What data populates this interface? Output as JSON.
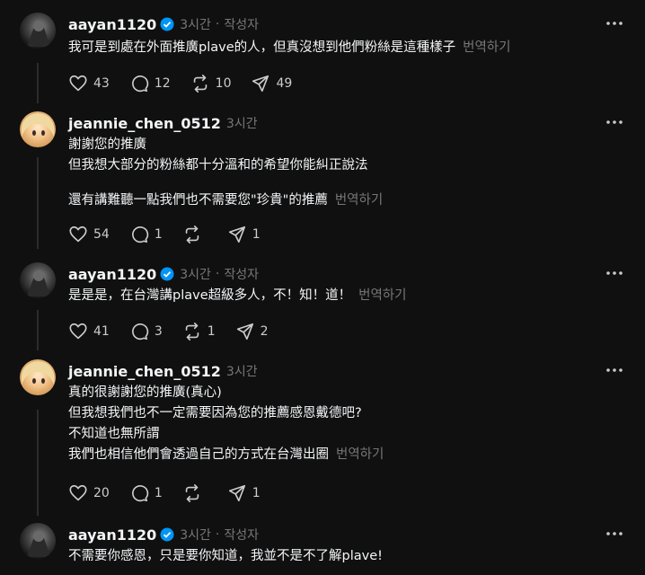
{
  "posts": [
    {
      "username": "aayan1120",
      "verified": true,
      "time": "3시간",
      "author_badge": "작성자",
      "lines": [
        "我可是到處在外面推廣plave的人，但真沒想到他們粉絲是這種樣子"
      ],
      "translate_label": "번역하기",
      "likes": "43",
      "comments": "12",
      "reposts": "10",
      "shares": "49"
    },
    {
      "username": "jeannie_chen_0512",
      "verified": false,
      "time": "3시간",
      "lines": [
        "謝謝您的推廣",
        "但我想大部分的粉絲都十分溫和的希望你能糾正說法",
        "",
        "還有講難聽一點我們也不需要您\"珍貴\"的推薦"
      ],
      "translate_label": "번역하기",
      "likes": "54",
      "comments": "1",
      "reposts": "",
      "shares": "1"
    },
    {
      "username": "aayan1120",
      "verified": true,
      "time": "3시간",
      "author_badge": "작성자",
      "lines": [
        "是是是，在台灣講plave超級多人，不！知！道！"
      ],
      "translate_label": "번역하기",
      "likes": "41",
      "comments": "3",
      "reposts": "1",
      "shares": "2"
    },
    {
      "username": "jeannie_chen_0512",
      "verified": false,
      "time": "3시간",
      "lines": [
        "真的很謝謝您的推廣(真心)",
        "但我想我們也不一定需要因為您的推薦感恩戴德吧?",
        "不知道也無所謂",
        "我們也相信他們會透過自己的方式在台灣出圈"
      ],
      "translate_label": "번역하기",
      "likes": "20",
      "comments": "1",
      "reposts": "",
      "shares": "1"
    },
    {
      "username": "aayan1120",
      "verified": true,
      "time": "3시간",
      "author_badge": "작성자",
      "lines": [
        "不需要你感恩，只是要你知道，我並不是不了解plave!"
      ]
    }
  ],
  "colors": {
    "background": "#101010",
    "text": "#f3f5f7",
    "muted": "#777777",
    "verified": "#0095f6"
  }
}
